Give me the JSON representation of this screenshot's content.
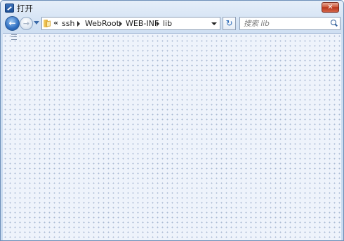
{
  "window": {
    "title": "打开",
    "close_label": "✕"
  },
  "nav": {
    "back_glyph": "←",
    "forward_glyph": "→",
    "refresh_glyph": "↻",
    "overflow_glyph": "«"
  },
  "address": {
    "breadcrumbs": [
      "ssh",
      "WebRoot",
      "WEB-INF",
      "lib"
    ]
  },
  "search": {
    "placeholder": "搜索 lib"
  },
  "icons": {
    "app": "app-icon",
    "folder": "folder-icon",
    "search": "search-icon"
  },
  "colors": {
    "accent": "#2f6fc1",
    "close": "#c7462a",
    "content_bg": "#eef3fb"
  }
}
